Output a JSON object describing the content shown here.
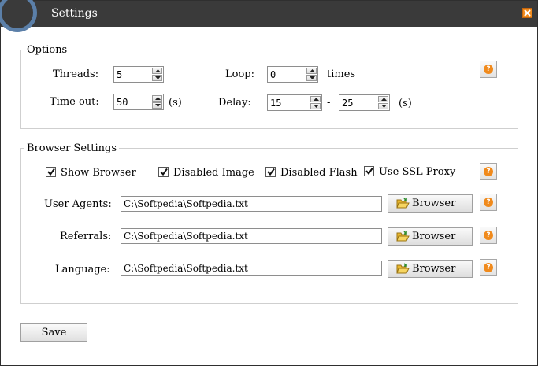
{
  "window": {
    "title": "Settings"
  },
  "options": {
    "legend": "Options",
    "threads": {
      "label": "Threads:",
      "value": "5"
    },
    "timeout": {
      "label": "Time out:",
      "value": "50",
      "unit": "(s)"
    },
    "loop": {
      "label": "Loop:",
      "value": "0",
      "unit": "times"
    },
    "delay": {
      "label": "Delay:",
      "from": "15",
      "separator": "-",
      "to": "25",
      "unit": "(s)"
    },
    "help": "?"
  },
  "browser_settings": {
    "legend": "Browser Settings",
    "checkboxes": [
      {
        "label": "Show Browser",
        "checked": true
      },
      {
        "label": "Disabled Image",
        "checked": true
      },
      {
        "label": "Disabled Flash",
        "checked": true
      },
      {
        "label": "Use SSL Proxy",
        "checked": true
      }
    ],
    "rows": [
      {
        "label": "User Agents:",
        "path": "C:\\Softpedia\\Softpedia.txt",
        "button": "Browser"
      },
      {
        "label": "Referrals:",
        "path": "C:\\Softpedia\\Softpedia.txt",
        "button": "Browser"
      },
      {
        "label": "Language:",
        "path": "C:\\Softpedia\\Softpedia.txt",
        "button": "Browser"
      }
    ],
    "help": "?"
  },
  "save_label": "Save",
  "colors": {
    "titlebar": "#3a3a3a",
    "accent": "#f08a1c",
    "border": "#cfcfcf"
  }
}
